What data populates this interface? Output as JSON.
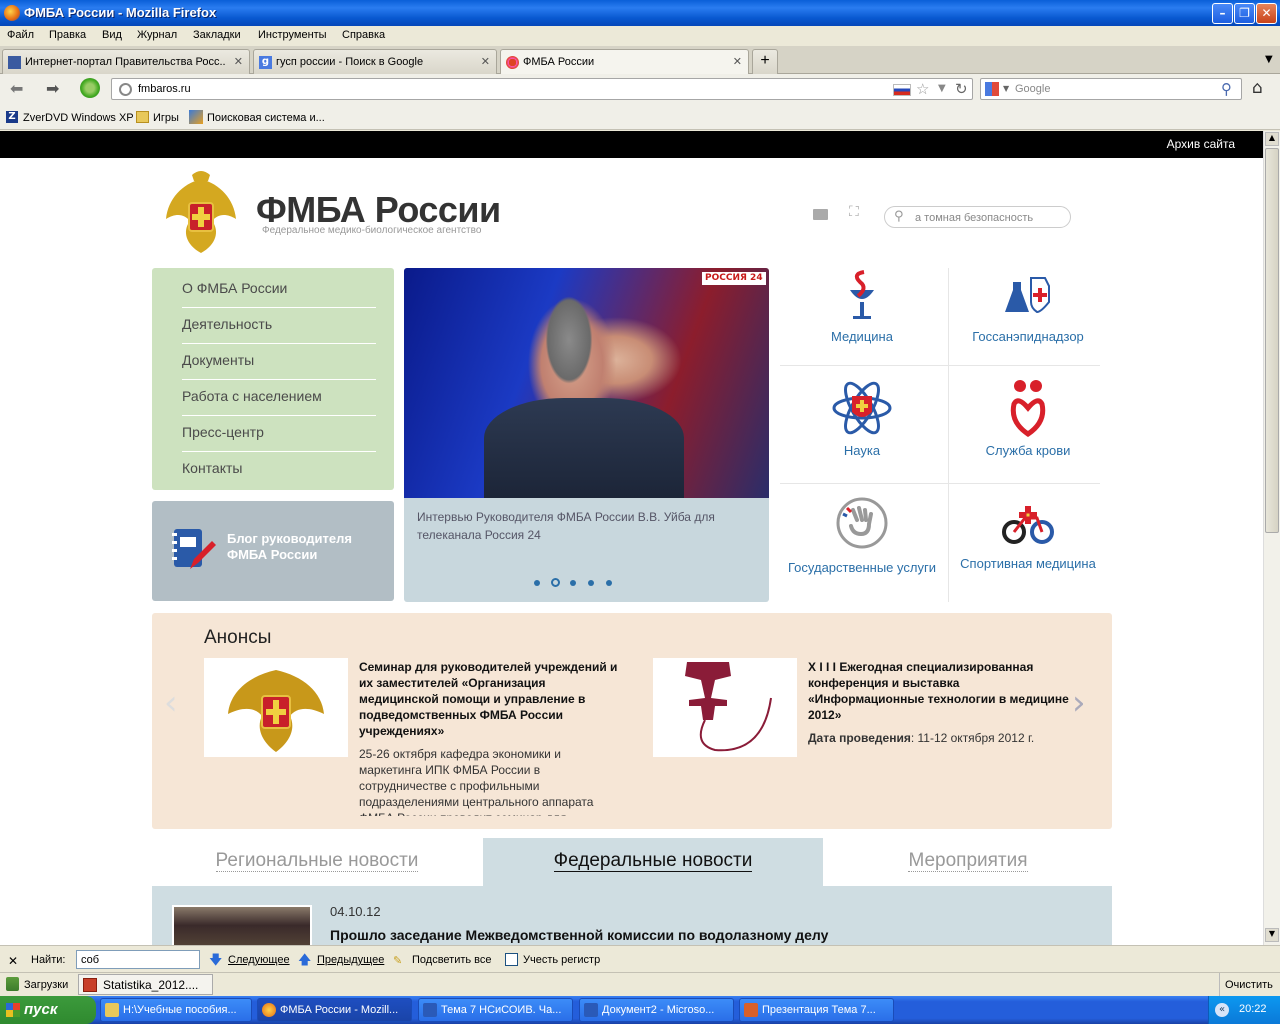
{
  "window": {
    "title": "ФМБА России - Mozilla Firefox"
  },
  "menu": [
    "Файл",
    "Правка",
    "Вид",
    "Журнал",
    "Закладки",
    "Инструменты",
    "Справка"
  ],
  "tabs": [
    {
      "label": "Интернет-портал Правительства Росс..."
    },
    {
      "label": "гусп россии - Поиск в Google"
    },
    {
      "label": "ФМБА России"
    }
  ],
  "nav": {
    "url": "fmbaros.ru",
    "search_placeholder": "Google"
  },
  "bookmarks": [
    "ZverDVD Windows XP",
    "Игры",
    "Поисковая система и..."
  ],
  "site": {
    "archive": "Архив сайта",
    "brand": "ФМБА России",
    "brand_sub": "Федеральное медико-биологическое агентство",
    "search_value": "а томная безопасность",
    "nav": [
      "О ФМБА России",
      "Деятельность",
      "Документы",
      "Работа с населением",
      "Пресс-центр",
      "Контакты"
    ],
    "blog": "Блог руководителя ФМБА России",
    "slide": {
      "badge": "РОССИЯ 24",
      "caption": "Интервью Руководителя ФМБА России В.В. Уйба для телеканала Россия 24"
    },
    "tiles": [
      "Медицина",
      "Госсанэпиднадзор",
      "Наука",
      "Служба крови",
      "Государственные услуги",
      "Спортивная медицина"
    ],
    "anons": {
      "heading": "Анонсы",
      "items": [
        {
          "title": "Семинар для руководителей учреждений и их заместителей «Организация медицинской помощи и управление в подведомственных ФМБА России учреждениях»",
          "body": "25-26 октября кафедра экономики и маркетинга ИПК ФМБА России в сотрудничестве с профильными подразделениями центрального аппарата ФМБА России проводит семинар для"
        },
        {
          "title": "X I I I Ежегодная специализированная конференция и выставка «Информационные технологии в медицине 2012»",
          "date_label": "Дата проведения",
          "date_value": ": 11-12 октября 2012 г."
        }
      ]
    },
    "news_tabs": [
      "Региональные новости",
      "Федеральные новости",
      "Мероприятия"
    ],
    "news": {
      "date": "04.10.12",
      "title": "Прошло заседание Межведомственной комиссии по водолазному делу"
    }
  },
  "findbar": {
    "label": "Найти:",
    "value": "соб",
    "next": "Следующее",
    "prev": "Предыдущее",
    "highlight": "Подсветить все",
    "match_case": "Учесть регистр"
  },
  "downloads": {
    "label": "Загрузки",
    "file": "Statistika_2012....",
    "clear": "Очистить"
  },
  "taskbar": {
    "start": "пуск",
    "tasks": [
      "H:\\Учебные пособия...",
      "ФМБА России - Mozill...",
      "Тема 7 НСиСОИВ. Ча...",
      "Документ2 - Microso...",
      "Презентация Тема 7..."
    ],
    "clock": "20:22"
  }
}
